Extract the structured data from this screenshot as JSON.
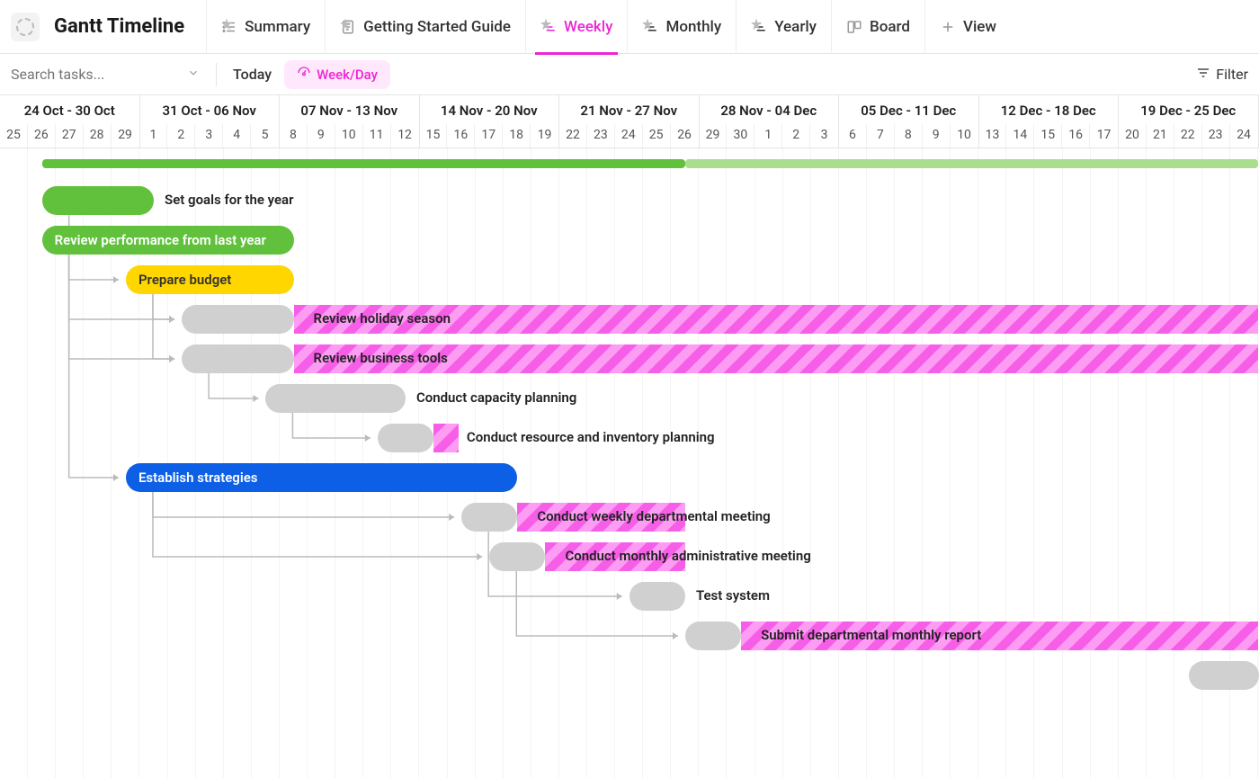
{
  "header": {
    "title": "Gantt Timeline",
    "tabs": [
      {
        "id": "summary",
        "label": "Summary",
        "icon": "list"
      },
      {
        "id": "guide",
        "label": "Getting Started Guide",
        "icon": "doc"
      },
      {
        "id": "weekly",
        "label": "Weekly",
        "icon": "gantt",
        "active": true
      },
      {
        "id": "monthly",
        "label": "Monthly",
        "icon": "gantt"
      },
      {
        "id": "yearly",
        "label": "Yearly",
        "icon": "gantt"
      },
      {
        "id": "board",
        "label": "Board",
        "icon": "board"
      },
      {
        "id": "addview",
        "label": "View",
        "icon": "plus"
      }
    ]
  },
  "toolbar": {
    "search_placeholder": "Search tasks...",
    "today_label": "Today",
    "range_label": "Week/Day",
    "filter_label": "Filter"
  },
  "timeline": {
    "day_width": 31.1,
    "weeks": [
      {
        "label": "24 Oct - 30 Oct",
        "days": [
          "25",
          "26",
          "27",
          "28",
          "29"
        ],
        "partial_left": true
      },
      {
        "label": "31 Oct - 06 Nov",
        "days": [
          "1",
          "2",
          "3",
          "4",
          "5"
        ]
      },
      {
        "label": "07 Nov - 13 Nov",
        "days": [
          "8",
          "9",
          "10",
          "11",
          "12"
        ]
      },
      {
        "label": "14 Nov - 20 Nov",
        "days": [
          "15",
          "16",
          "17",
          "18",
          "19"
        ]
      },
      {
        "label": "21 Nov - 27 Nov",
        "days": [
          "22",
          "23",
          "24",
          "25",
          "26"
        ]
      },
      {
        "label": "28 Nov - 04 Dec",
        "days": [
          "29",
          "30",
          "1",
          "2",
          "3"
        ]
      },
      {
        "label": "05 Dec - 11 Dec",
        "days": [
          "6",
          "7",
          "8",
          "9",
          "10"
        ]
      },
      {
        "label": "12 Dec - 18 Dec",
        "days": [
          "13",
          "14",
          "15",
          "16",
          "17"
        ]
      },
      {
        "label": "19 Dec - 25 Dec",
        "days": [
          "20",
          "21",
          "22",
          "23",
          "24"
        ]
      }
    ]
  },
  "chart_data": {
    "type": "gantt",
    "summary": {
      "solid_start": 1.5,
      "solid_end": 24.5,
      "light_end": 45
    },
    "tasks": [
      {
        "id": "t1",
        "label": "Set goals for the year",
        "color": "green",
        "start": 1.5,
        "end": 5.5,
        "label_out": true
      },
      {
        "id": "t2",
        "label": "Review performance from last year",
        "color": "green",
        "start": 1.5,
        "end": 10.5,
        "label_in": true
      },
      {
        "id": "t3",
        "label": "Prepare budget",
        "color": "yellow",
        "start": 4.5,
        "end": 10.5,
        "label_in": true
      },
      {
        "id": "t4",
        "label": "Review holiday season",
        "color": "gray",
        "start": 6.5,
        "end": 10.5,
        "striped_from": 10.5,
        "striped_to": 45,
        "label_in_stripe": true
      },
      {
        "id": "t5",
        "label": "Review business tools",
        "color": "gray",
        "start": 6.5,
        "end": 10.5,
        "striped_from": 10.5,
        "striped_to": 45,
        "label_in_stripe": true
      },
      {
        "id": "t6",
        "label": "Conduct capacity planning",
        "color": "gray",
        "start": 9.5,
        "end": 14.5,
        "label_out": true
      },
      {
        "id": "t7",
        "label": "Conduct resource and inventory planning",
        "color": "gray",
        "start": 13.5,
        "end": 15.5,
        "striped_from": 15.5,
        "striped_to": 16.3,
        "label_out": true
      },
      {
        "id": "t8",
        "label": "Establish strategies",
        "color": "blue",
        "start": 4.5,
        "end": 18.5,
        "label_in": true
      },
      {
        "id": "t9",
        "label": "Conduct weekly departmental meeting",
        "color": "gray",
        "start": 16.5,
        "end": 18.5,
        "striped_from": 18.5,
        "striped_to": 24.5,
        "label_in_stripe": true
      },
      {
        "id": "t10",
        "label": "Conduct monthly administrative meeting",
        "color": "gray",
        "start": 17.5,
        "end": 19.5,
        "striped_from": 19.5,
        "striped_to": 24.5,
        "label_in_stripe": true
      },
      {
        "id": "t11",
        "label": "Test system",
        "color": "gray",
        "start": 22.5,
        "end": 24.5,
        "label_out": true
      },
      {
        "id": "t12",
        "label": "Submit departmental monthly report",
        "color": "gray",
        "start": 24.5,
        "end": 26.5,
        "striped_from": 26.5,
        "striped_to": 45,
        "label_in_stripe": true
      },
      {
        "id": "t13",
        "label": "",
        "color": "gray",
        "start": 42.5,
        "end": 45
      }
    ],
    "dependencies": [
      {
        "from": "t1",
        "to": "t3"
      },
      {
        "from": "t2",
        "to": "t4"
      },
      {
        "from": "t2",
        "to": "t5"
      },
      {
        "from": "t3",
        "to": "t4"
      },
      {
        "from": "t3",
        "to": "t5"
      },
      {
        "from": "t5",
        "to": "t6"
      },
      {
        "from": "t6",
        "to": "t7"
      },
      {
        "from": "t2",
        "to": "t8"
      },
      {
        "from": "t8",
        "to": "t9"
      },
      {
        "from": "t8",
        "to": "t10"
      },
      {
        "from": "t9",
        "to": "t11"
      },
      {
        "from": "t10",
        "to": "t12"
      }
    ]
  }
}
